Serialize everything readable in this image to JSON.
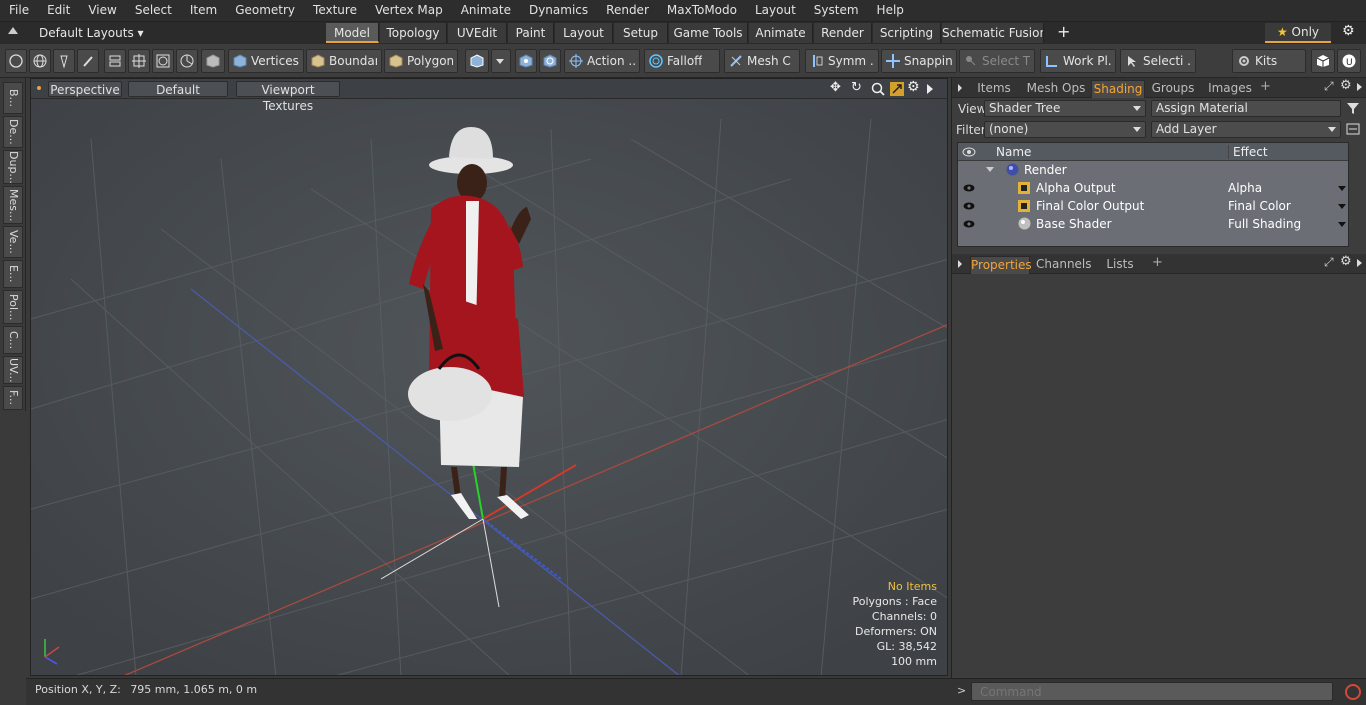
{
  "menu": [
    "File",
    "Edit",
    "View",
    "Select",
    "Item",
    "Geometry",
    "Texture",
    "Vertex Map",
    "Animate",
    "Dynamics",
    "Render",
    "MaxToModo",
    "Layout",
    "System",
    "Help"
  ],
  "layout_selector": "Default Layouts",
  "layout_tabs": [
    "Model",
    "Topology",
    "UVEdit",
    "Paint",
    "Layout",
    "Setup",
    "Game Tools",
    "Animate",
    "Render",
    "Scripting",
    "Schematic Fusion"
  ],
  "active_layout_tab": "Model",
  "only_label": "Only",
  "toolbar": {
    "vertices": "Vertices",
    "boundary": "Boundary",
    "polygons": "Polygons",
    "action": "Action ...",
    "falloff": "Falloff",
    "meshc": "Mesh C ...",
    "symm": "Symm ...",
    "snapping": "Snapping",
    "select_t": "Select T...",
    "workpl": "Work Pl...",
    "selecti": "Selecti ...",
    "kits": "Kits"
  },
  "left_tabs": [
    "B...",
    "De...",
    "Dup...",
    "Mes...",
    "Ve...",
    "E...",
    "Pol...",
    "C...",
    "UV...",
    "F..."
  ],
  "viewport": {
    "view": "Perspective",
    "shading": "Default",
    "texture": "Viewport Textures",
    "info": {
      "items": "No Items",
      "polygons": "Polygons : Face",
      "channels": "Channels: 0",
      "deformers": "Deformers: ON",
      "gl": "GL: 38,542",
      "scale": "100 mm"
    }
  },
  "status": {
    "label": "Position X, Y, Z:",
    "value": "795 mm, 1.065 m, 0 m"
  },
  "right_panel": {
    "tabs": [
      "Items",
      "Mesh Ops",
      "Shading",
      "Groups",
      "Images"
    ],
    "active_tab": "Shading",
    "view_label": "View",
    "view_value": "Shader Tree",
    "assign": "Assign Material",
    "filter_label": "Filter",
    "filter_value": "(none)",
    "add_layer": "Add Layer",
    "col_name": "Name",
    "col_effect": "Effect",
    "rows": [
      {
        "name": "Render",
        "effect": ""
      },
      {
        "name": "Alpha Output",
        "effect": "Alpha"
      },
      {
        "name": "Final Color Output",
        "effect": "Final Color"
      },
      {
        "name": "Base Shader",
        "effect": "Full Shading"
      }
    ],
    "prop_tabs": [
      "Properties",
      "Channels",
      "Lists"
    ],
    "active_prop_tab": "Properties"
  },
  "command": {
    "placeholder": "Command"
  },
  "colors": {
    "accent": "#f3a53a",
    "viewport_bg": "#464a4e",
    "x_axis": "#c0392b",
    "y_axis": "#27c227",
    "z_axis": "#3050c8"
  }
}
